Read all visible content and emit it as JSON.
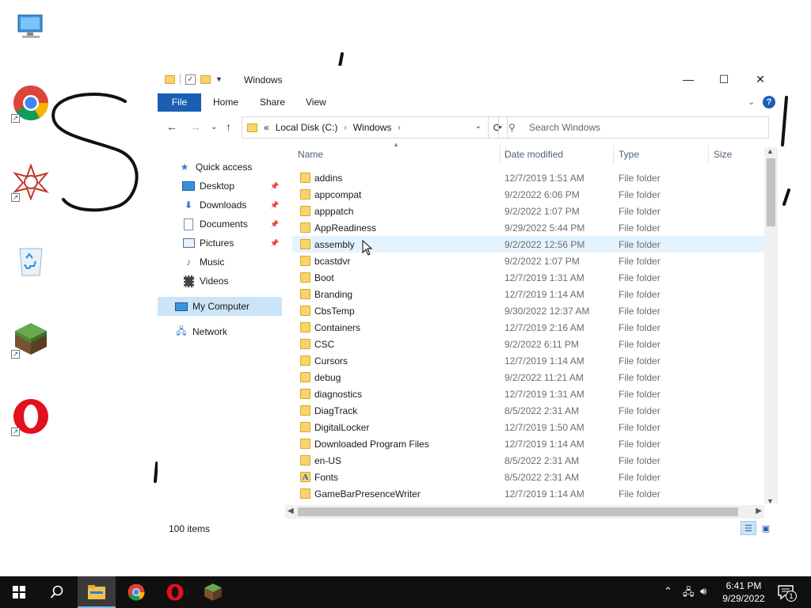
{
  "desktop": {
    "icons": [
      {
        "name": "This PC",
        "icon": "computer-icon"
      },
      {
        "name": "Google Chrome",
        "icon": "chrome-icon",
        "shortcut": true
      },
      {
        "name": "Maple",
        "icon": "maple-icon",
        "shortcut": true
      },
      {
        "name": "Recycle Bin",
        "icon": "recycle-bin-icon"
      },
      {
        "name": "Minecraft",
        "icon": "minecraft-icon",
        "shortcut": true
      },
      {
        "name": "Opera",
        "icon": "opera-icon",
        "shortcut": true
      }
    ],
    "note": "Large hand-drawn text at top of desktop omitted (offensive content)."
  },
  "window": {
    "title": "Windows",
    "controls": {
      "minimize": "—",
      "maximize": "☐",
      "close": "✕"
    }
  },
  "ribbon": {
    "tabs": [
      "File",
      "Home",
      "Share",
      "View"
    ],
    "accent": "#1a5fb4",
    "help": "?"
  },
  "address": {
    "overflow": "«",
    "crumbs": [
      "Local Disk (C:)",
      "Windows"
    ],
    "separator": "›"
  },
  "search": {
    "placeholder": "Search Windows"
  },
  "nav": [
    {
      "label": "Quick access",
      "icon": "star-icon"
    },
    {
      "label": "Desktop",
      "icon": "desktop-folder-icon",
      "pinned": true
    },
    {
      "label": "Downloads",
      "icon": "download-arrow-icon",
      "pinned": true
    },
    {
      "label": "Documents",
      "icon": "documents-icon",
      "pinned": true
    },
    {
      "label": "Pictures",
      "icon": "pictures-icon",
      "pinned": true
    },
    {
      "label": "Music",
      "icon": "music-note-icon"
    },
    {
      "label": "Videos",
      "icon": "film-icon"
    },
    {
      "label": "My Computer",
      "icon": "computer-icon",
      "selected": true
    },
    {
      "label": "Network",
      "icon": "network-icon"
    }
  ],
  "columns": {
    "name": "Name",
    "date": "Date modified",
    "type": "Type",
    "size": "Size"
  },
  "files": [
    {
      "name": "addins",
      "date": "12/7/2019 1:51 AM",
      "type": "File folder"
    },
    {
      "name": "appcompat",
      "date": "9/2/2022 6:06 PM",
      "type": "File folder"
    },
    {
      "name": "apppatch",
      "date": "9/2/2022 1:07 PM",
      "type": "File folder"
    },
    {
      "name": "AppReadiness",
      "date": "9/29/2022 5:44 PM",
      "type": "File folder"
    },
    {
      "name": "assembly",
      "date": "9/2/2022 12:56 PM",
      "type": "File folder",
      "hover": true
    },
    {
      "name": "bcastdvr",
      "date": "9/2/2022 1:07 PM",
      "type": "File folder"
    },
    {
      "name": "Boot",
      "date": "12/7/2019 1:31 AM",
      "type": "File folder"
    },
    {
      "name": "Branding",
      "date": "12/7/2019 1:14 AM",
      "type": "File folder"
    },
    {
      "name": "CbsTemp",
      "date": "9/30/2022 12:37 AM",
      "type": "File folder"
    },
    {
      "name": "Containers",
      "date": "12/7/2019 2:16 AM",
      "type": "File folder"
    },
    {
      "name": "CSC",
      "date": "9/2/2022 6:11 PM",
      "type": "File folder"
    },
    {
      "name": "Cursors",
      "date": "12/7/2019 1:14 AM",
      "type": "File folder"
    },
    {
      "name": "debug",
      "date": "9/2/2022 11:21 AM",
      "type": "File folder"
    },
    {
      "name": "diagnostics",
      "date": "12/7/2019 1:31 AM",
      "type": "File folder"
    },
    {
      "name": "DiagTrack",
      "date": "8/5/2022 2:31 AM",
      "type": "File folder"
    },
    {
      "name": "DigitalLocker",
      "date": "12/7/2019 1:50 AM",
      "type": "File folder"
    },
    {
      "name": "Downloaded Program Files",
      "date": "12/7/2019 1:14 AM",
      "type": "File folder"
    },
    {
      "name": "en-US",
      "date": "8/5/2022 2:31 AM",
      "type": "File folder"
    },
    {
      "name": "Fonts",
      "date": "8/5/2022 2:31 AM",
      "type": "File folder",
      "special": "font"
    },
    {
      "name": "GameBarPresenceWriter",
      "date": "12/7/2019 1:14 AM",
      "type": "File folder"
    }
  ],
  "status": {
    "item_count": "100 items"
  },
  "taskbar": {
    "apps": [
      "start-icon",
      "search-icon",
      "file-explorer-icon",
      "chrome-icon",
      "opera-icon",
      "minecraft-icon"
    ],
    "active": "file-explorer-icon",
    "clock": {
      "time": "6:41 PM",
      "date": "9/29/2022"
    },
    "notification_count": "1"
  }
}
